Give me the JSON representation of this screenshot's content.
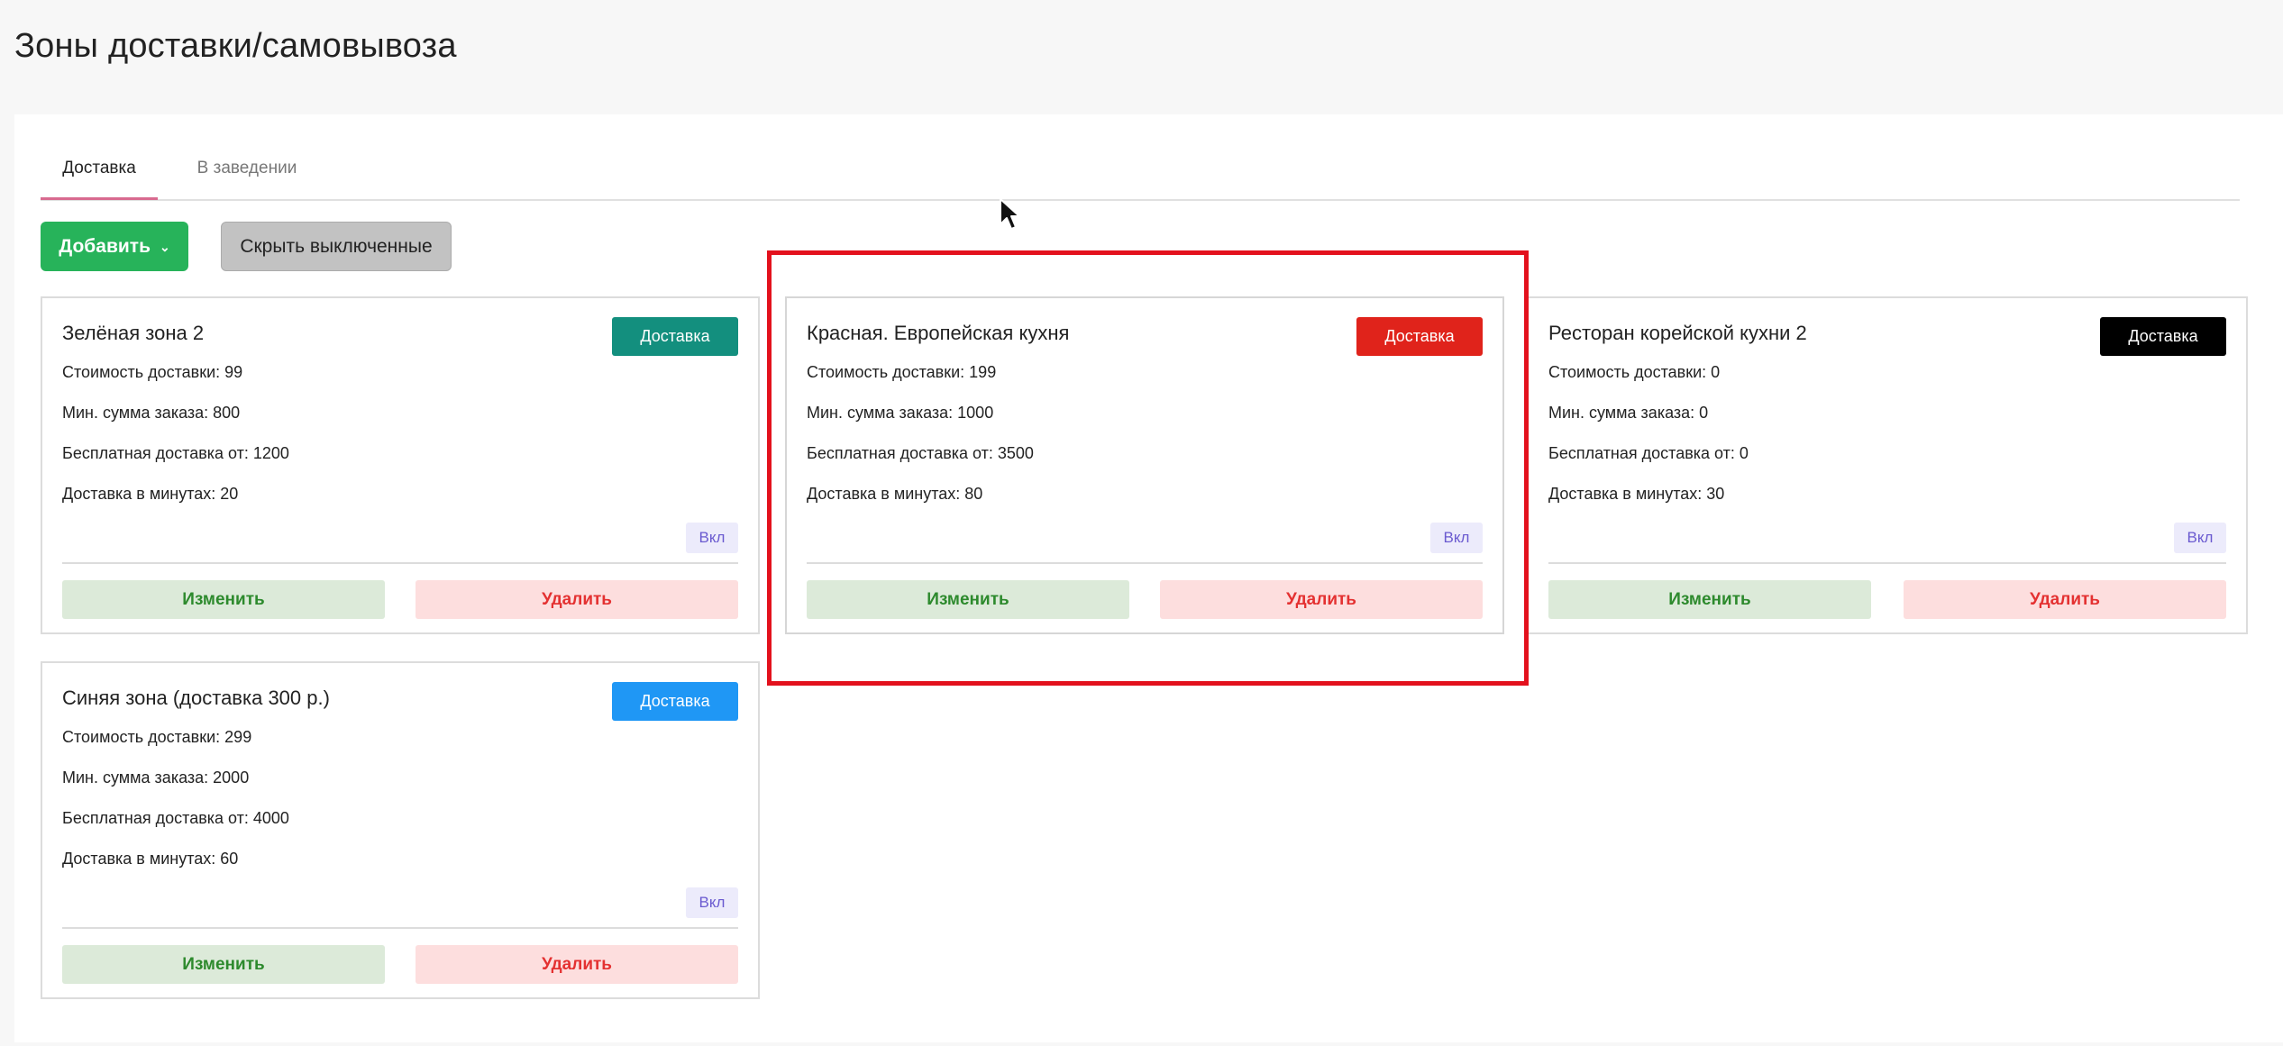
{
  "page": {
    "title": "Зоны доставки/самовывоза"
  },
  "tabs": [
    {
      "label": "Доставка",
      "active": true
    },
    {
      "label": "В заведении",
      "active": false
    }
  ],
  "toolbar": {
    "add_label": "Добавить",
    "hide_label": "Скрыть выключенные"
  },
  "zones": [
    {
      "name": "Зелёная зона 2",
      "badge": "Доставка",
      "badge_color": "#138f7e",
      "cost": "Стоимость доставки: 99",
      "min_order": "Мин. сумма заказа: 800",
      "free_from": "Бесплатная доставка от: 1200",
      "minutes": "Доставка в минутах: 20",
      "toggle": "Вкл",
      "edit": "Изменить",
      "delete": "Удалить"
    },
    {
      "name": "Красная. Европейская кухня",
      "badge": "Доставка",
      "badge_color": "#e0231b",
      "cost": "Стоимость доставки: 199",
      "min_order": "Мин. сумма заказа: 1000",
      "free_from": "Бесплатная доставка от: 3500",
      "minutes": "Доставка в минутах: 80",
      "toggle": "Вкл",
      "edit": "Изменить",
      "delete": "Удалить"
    },
    {
      "name": "Ресторан корейской кухни 2",
      "badge": "Доставка",
      "badge_color": "#000000",
      "cost": "Стоимость доставки: 0",
      "min_order": "Мин. сумма заказа: 0",
      "free_from": "Бесплатная доставка от: 0",
      "minutes": "Доставка в минутах: 30",
      "toggle": "Вкл",
      "edit": "Изменить",
      "delete": "Удалить"
    },
    {
      "name": "Синяя зона (доставка 300 р.)",
      "badge": "Доставка",
      "badge_color": "#1f97f5",
      "cost": "Стоимость доставки: 299",
      "min_order": "Мин. сумма заказа: 2000",
      "free_from": "Бесплатная доставка от: 4000",
      "minutes": "Доставка в минутах: 60",
      "toggle": "Вкл",
      "edit": "Изменить",
      "delete": "Удалить"
    }
  ],
  "icons": {
    "add_chevron": "chevron-down-icon",
    "cursor": "mouse-pointer-icon"
  },
  "highlight_color": "#e3111d"
}
